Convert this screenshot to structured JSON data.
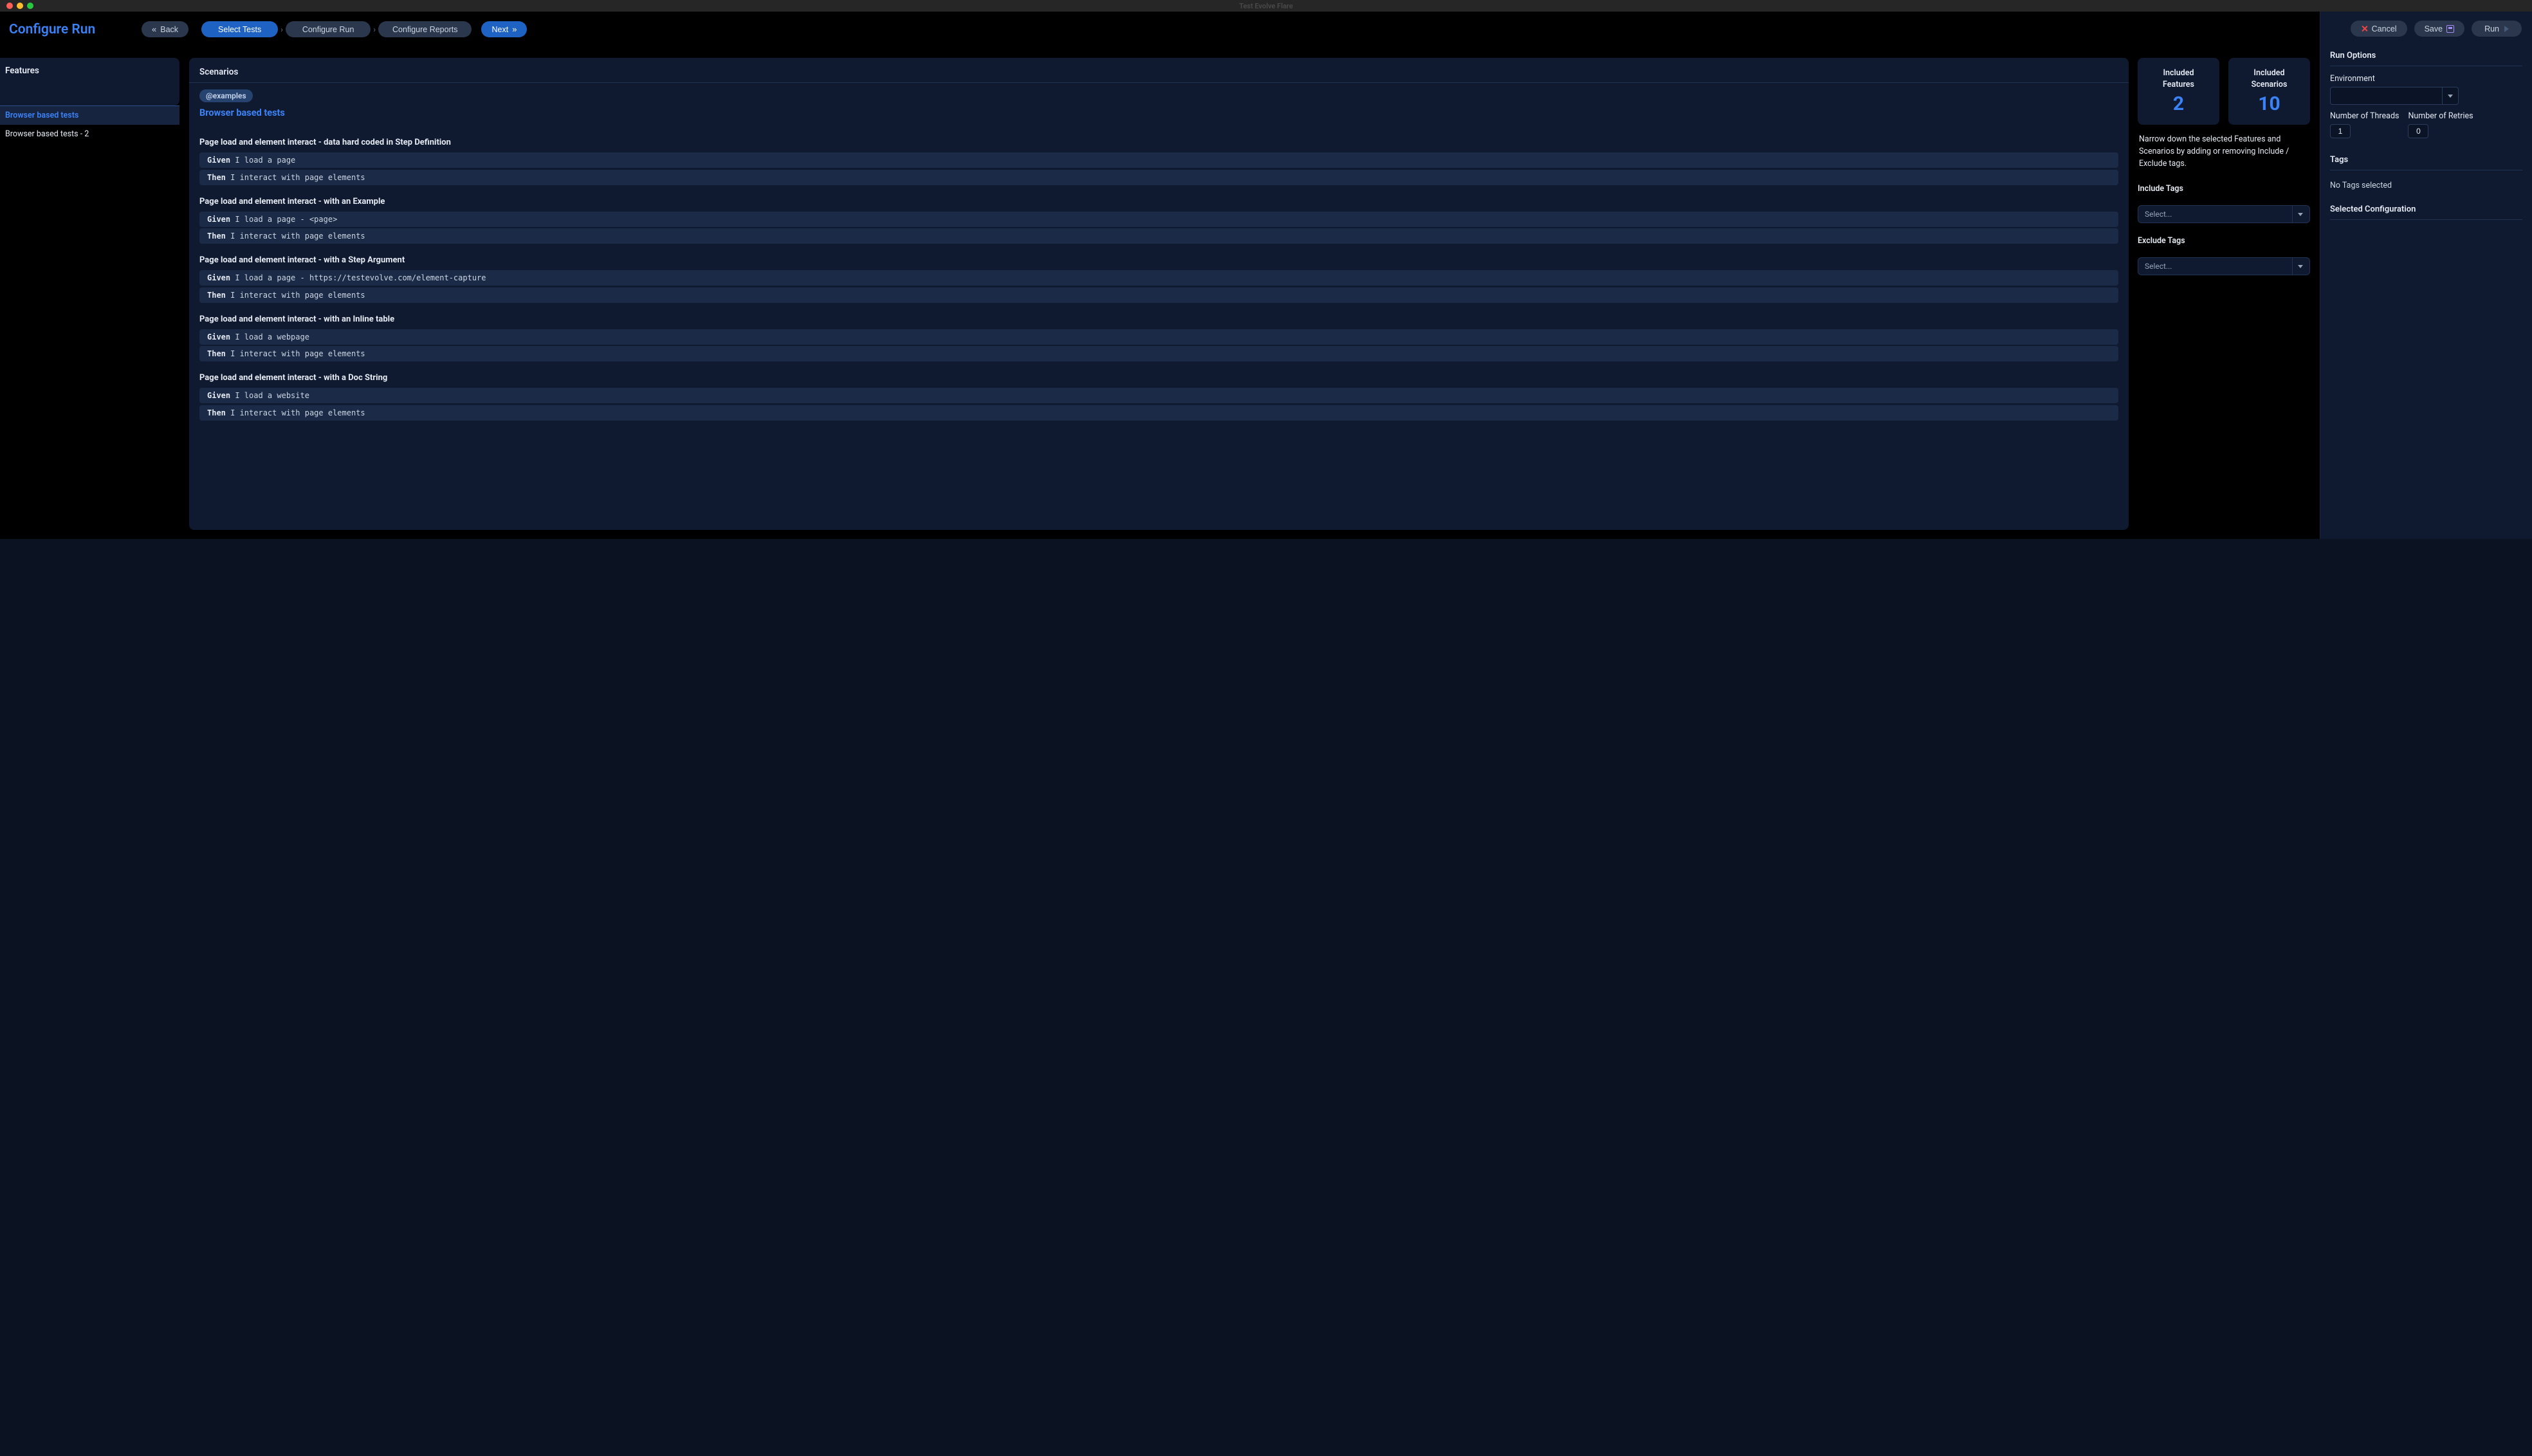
{
  "titlebar": {
    "title": "Test Evolve Flare"
  },
  "header": {
    "page_title": "Configure Run",
    "back_label": "Back",
    "next_label": "Next",
    "crumbs": {
      "select_tests": "Select Tests",
      "configure_run": "Configure Run",
      "configure_reports": "Configure Reports"
    }
  },
  "features": {
    "panel_title": "Features",
    "items": [
      {
        "label": "Browser based tests",
        "active": true
      },
      {
        "label": "Browser based tests - 2",
        "active": false
      }
    ]
  },
  "scenarios": {
    "panel_title": "Scenarios",
    "tag": "@examples",
    "feature_name": "Browser based tests",
    "list": [
      {
        "title": "Page load and element interact - data hard coded in Step Definition",
        "steps": [
          {
            "kw": "Given",
            "text": "I load a page"
          },
          {
            "kw": "Then",
            "text": "I interact with page elements"
          }
        ]
      },
      {
        "title": "Page load and element interact - with an Example",
        "steps": [
          {
            "kw": "Given",
            "text": "I load a page - <page>"
          },
          {
            "kw": "Then",
            "text": "I interact with page elements"
          }
        ]
      },
      {
        "title": "Page load and element interact - with a Step Argument",
        "steps": [
          {
            "kw": "Given",
            "text": "I load a page - https://testevolve.com/element-capture"
          },
          {
            "kw": "Then",
            "text": "I interact with page elements"
          }
        ]
      },
      {
        "title": "Page load and element interact - with an Inline table",
        "steps": [
          {
            "kw": "Given",
            "text": "I load a webpage"
          },
          {
            "kw": "Then",
            "text": "I interact with page elements"
          }
        ]
      },
      {
        "title": "Page load and element interact - with a Doc String",
        "steps": [
          {
            "kw": "Given",
            "text": "I load a website"
          },
          {
            "kw": "Then",
            "text": "I interact with page elements"
          }
        ]
      }
    ]
  },
  "stats": {
    "included_features_label": "Included\nFeatures",
    "included_features_val": "2",
    "included_scenarios_label": "Included\nScenarios",
    "included_scenarios_val": "10",
    "narrow_text": "Narrow down the selected Features and Scenarios by adding or removing Include / Exclude tags.",
    "include_tags_label": "Include Tags",
    "exclude_tags_label": "Exclude Tags",
    "select_placeholder": "Select..."
  },
  "sidepanel": {
    "cancel_label": "Cancel",
    "save_label": "Save",
    "run_label": "Run",
    "run_options_label": "Run Options",
    "environment_label": "Environment",
    "threads_label": "Number of Threads",
    "threads_val": "1",
    "retries_label": "Number of Retries",
    "retries_val": "0",
    "tags_label": "Tags",
    "tags_empty": "No Tags selected",
    "selected_config_label": "Selected Configuration"
  }
}
